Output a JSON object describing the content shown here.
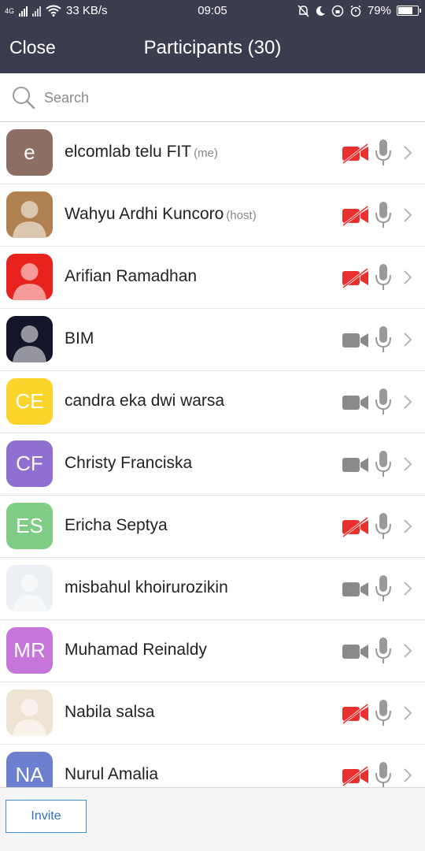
{
  "status_bar": {
    "network_type": "4G",
    "speed": "33 KB/s",
    "time": "09:05",
    "battery": "79%",
    "battery_level": 0.79
  },
  "header": {
    "close_label": "Close",
    "title": "Participants (30)"
  },
  "search": {
    "placeholder": "Search"
  },
  "participants": [
    {
      "name": "elcomlab telu FIT",
      "tag": "(me)",
      "avatar_text": "e",
      "avatar_color": "#8d6e63",
      "video_on": false,
      "avatar_type": "letter"
    },
    {
      "name": "Wahyu Ardhi Kuncoro",
      "tag": "(host)",
      "avatar_text": "",
      "avatar_color": "#b08050",
      "video_on": false,
      "avatar_type": "photo"
    },
    {
      "name": "Arifian Ramadhan",
      "tag": "",
      "avatar_text": "",
      "avatar_color": "#e8231f",
      "video_on": false,
      "avatar_type": "photo"
    },
    {
      "name": "BIM",
      "tag": "",
      "avatar_text": "",
      "avatar_color": "#14142a",
      "video_on": true,
      "avatar_type": "photo"
    },
    {
      "name": "candra eka dwi warsa",
      "tag": "",
      "avatar_text": "CE",
      "avatar_color": "#fbd52b",
      "video_on": true,
      "avatar_type": "letter"
    },
    {
      "name": "Christy Franciska",
      "tag": "",
      "avatar_text": "CF",
      "avatar_color": "#8f6fcf",
      "video_on": true,
      "avatar_type": "letter"
    },
    {
      "name": "Ericha Septya",
      "tag": "",
      "avatar_text": "ES",
      "avatar_color": "#7fcc84",
      "video_on": false,
      "avatar_type": "letter"
    },
    {
      "name": "misbahul khoirurozikin",
      "tag": "",
      "avatar_text": "",
      "avatar_color": "#eceff3",
      "video_on": true,
      "avatar_type": "photo"
    },
    {
      "name": "Muhamad Reinaldy",
      "tag": "",
      "avatar_text": "MR",
      "avatar_color": "#c676d9",
      "video_on": true,
      "avatar_type": "letter"
    },
    {
      "name": "Nabila salsa",
      "tag": "",
      "avatar_text": "",
      "avatar_color": "#efe3d3",
      "video_on": false,
      "avatar_type": "photo"
    },
    {
      "name": "Nurul Amalia",
      "tag": "",
      "avatar_text": "NA",
      "avatar_color": "#6d7fcf",
      "video_on": false,
      "avatar_type": "letter"
    }
  ],
  "footer": {
    "invite_label": "Invite"
  },
  "colors": {
    "header_bg": "#3c3c4f",
    "video_off": "#e8302f",
    "video_on": "#8a8a8a",
    "mic": "#9a9a9a",
    "accent": "#2f72c2"
  }
}
